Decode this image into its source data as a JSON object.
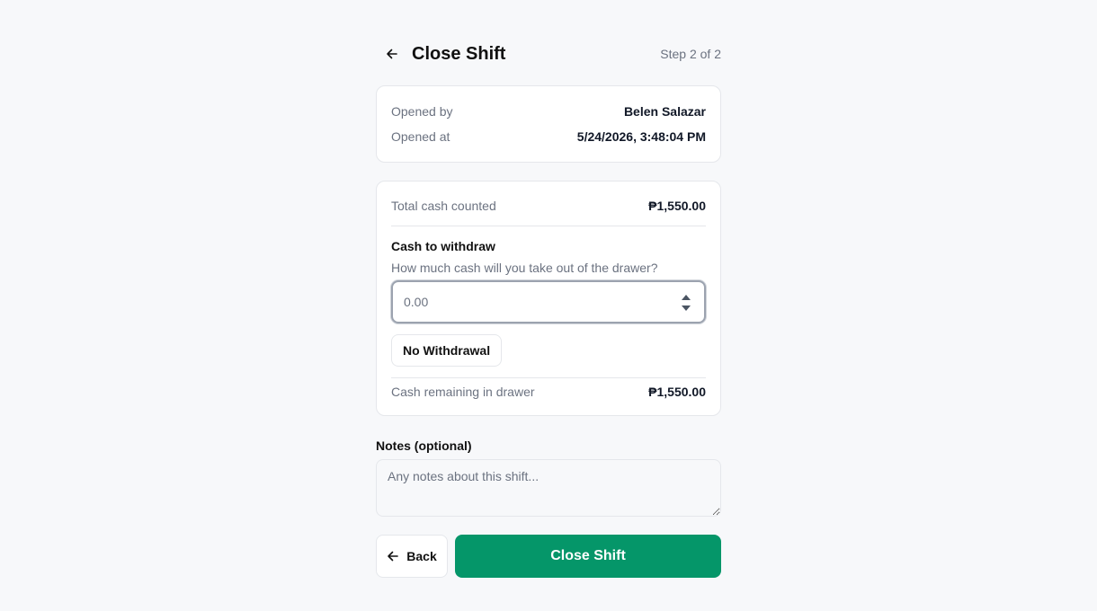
{
  "header": {
    "title": "Close Shift",
    "step": "Step 2 of 2"
  },
  "shift_info": {
    "opened_by_label": "Opened by",
    "opened_by_value": "Belen Salazar",
    "opened_at_label": "Opened at",
    "opened_at_value": "5/24/2026, 3:48:04 PM"
  },
  "cash": {
    "total_label": "Total cash counted",
    "total_value": "₱1,550.00",
    "withdraw_title": "Cash to withdraw",
    "withdraw_help": "How much cash will you take out of the drawer?",
    "withdraw_placeholder": "0.00",
    "no_withdrawal_label": "No Withdrawal",
    "remaining_label": "Cash remaining in drawer",
    "remaining_value": "₱1,550.00"
  },
  "notes": {
    "label": "Notes (optional)",
    "placeholder": "Any notes about this shift..."
  },
  "actions": {
    "back_label": "Back",
    "close_label": "Close Shift"
  },
  "colors": {
    "primary": "#059669",
    "background": "#f7f8fa"
  }
}
